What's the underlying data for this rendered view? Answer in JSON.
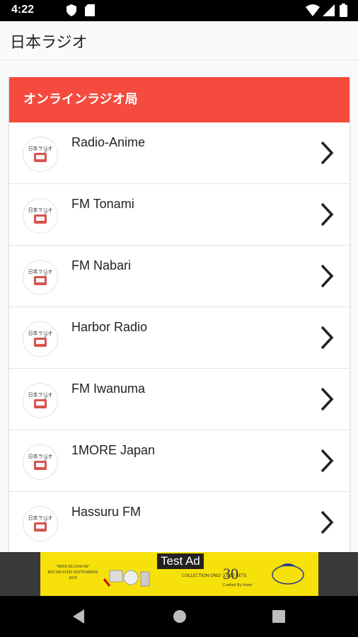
{
  "status_bar": {
    "time": "4:22"
  },
  "app_bar": {
    "title": "日本ラジオ"
  },
  "card": {
    "header": "オンラインラジオ局",
    "stations": [
      {
        "name": "Radio-Anime"
      },
      {
        "name": "FM Tonami"
      },
      {
        "name": "FM Nabari"
      },
      {
        "name": "Harbor Radio"
      },
      {
        "name": "FM Iwanuma"
      },
      {
        "name": "1MORE Japan"
      },
      {
        "name": "Hassuru FM"
      }
    ],
    "logo_text": "日本ラジオ"
  },
  "ad": {
    "badge": "Test Ad",
    "left_text": "\"MINI BLOSSOM\" RECREATED SEPTEMBER 2019",
    "collection_text": "COLLECTION ONLY 3,000 SETS",
    "number_30": "30",
    "crafted": "Crafted By Heart"
  },
  "colors": {
    "header": "#f44b3e",
    "ad": "#f6e10b"
  }
}
